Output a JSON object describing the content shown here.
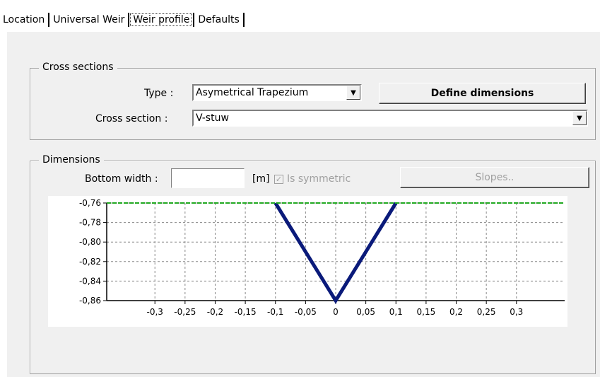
{
  "tabs": [
    {
      "label": "Location"
    },
    {
      "label": "Universal Weir"
    },
    {
      "label": "Weir profile"
    },
    {
      "label": "Defaults"
    }
  ],
  "cross_sections": {
    "title": "Cross sections",
    "type_label": "Type :",
    "type_value": "Asymetrical Trapezium",
    "define_button": "Define dimensions",
    "cross_section_label": "Cross section :",
    "cross_section_value": "V-stuw"
  },
  "dimensions": {
    "title": "Dimensions",
    "bottom_width_label": "Bottom width :",
    "bottom_width_value": "",
    "unit": "[m]",
    "symmetric_label": "Is symmetric",
    "symmetric_checked": true,
    "slopes_button": "Slopes.."
  },
  "chart_data": {
    "type": "line",
    "xlim": [
      -0.38,
      0.38
    ],
    "ylim": [
      -0.86,
      -0.76
    ],
    "x_ticks": [
      "-0,3",
      "-0,25",
      "-0,2",
      "-0,15",
      "-0,1",
      "-0,05",
      "0",
      "0,05",
      "0,1",
      "0,15",
      "0,2",
      "0,25",
      "0,3"
    ],
    "x_tick_values": [
      -0.3,
      -0.25,
      -0.2,
      -0.15,
      -0.1,
      -0.05,
      0,
      0.05,
      0.1,
      0.15,
      0.2,
      0.25,
      0.3
    ],
    "y_ticks": [
      "-0,76",
      "-0,78",
      "-0,80",
      "-0,82",
      "-0,84",
      "-0,86"
    ],
    "y_tick_values": [
      -0.76,
      -0.78,
      -0.8,
      -0.82,
      -0.84,
      -0.86
    ],
    "grid": true,
    "series": [
      {
        "color": "#0a1a7a",
        "x": [
          -0.1,
          0,
          0.1
        ],
        "y": [
          -0.76,
          -0.86,
          -0.76
        ]
      },
      {
        "color": "#22aa22",
        "x": [
          -0.38,
          0.38
        ],
        "y": [
          -0.76,
          -0.76
        ]
      }
    ]
  }
}
